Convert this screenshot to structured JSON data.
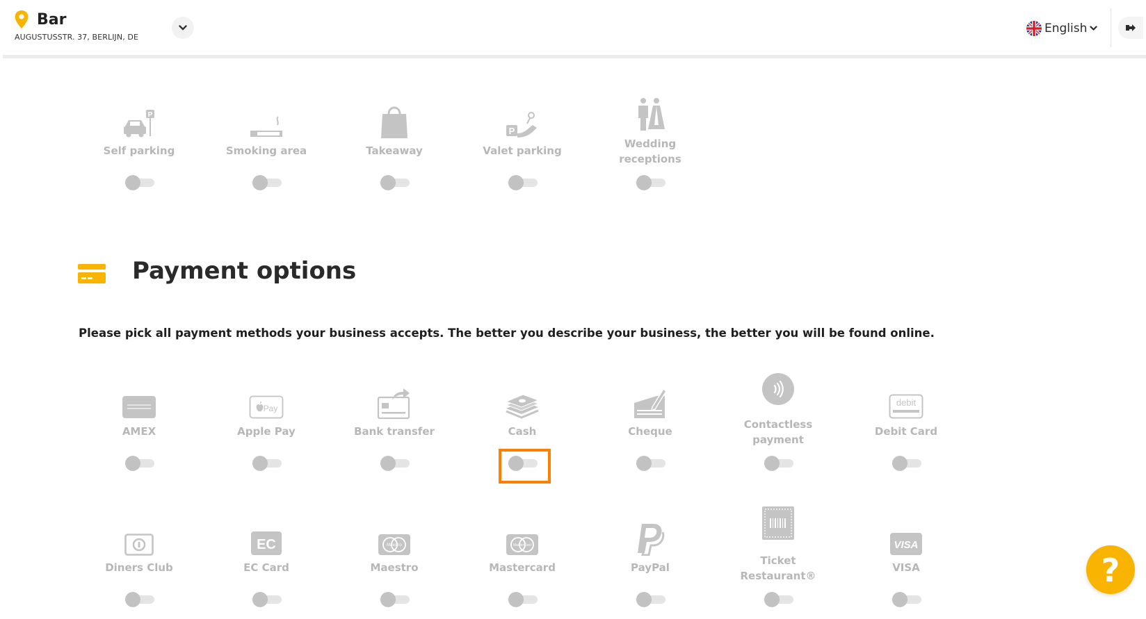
{
  "header": {
    "business_name": "Bar",
    "business_address": "AUGUSTUSSTR. 37, BERLIJN, DE",
    "language": "English"
  },
  "amenities": {
    "items": [
      {
        "label": "Self parking",
        "icon": "self-parking-icon",
        "enabled": false
      },
      {
        "label": "Smoking area",
        "icon": "cigarette-icon",
        "enabled": false
      },
      {
        "label": "Takeaway",
        "icon": "shopping-bag-icon",
        "enabled": false
      },
      {
        "label": "Valet parking",
        "icon": "valet-parking-icon",
        "enabled": false
      },
      {
        "label": "Wedding receptions",
        "icon": "wedding-couple-icon",
        "enabled": false
      }
    ]
  },
  "payment": {
    "title": "Payment options",
    "description": "Please pick all payment methods your business accepts. The better you describe your business, the better you will be found online.",
    "items": [
      {
        "label": "AMEX",
        "icon": "amex-icon",
        "enabled": false
      },
      {
        "label": "Apple Pay",
        "icon": "apple-pay-icon",
        "enabled": false
      },
      {
        "label": "Bank transfer",
        "icon": "bank-transfer-icon",
        "enabled": false
      },
      {
        "label": "Cash",
        "icon": "cash-icon",
        "enabled": false,
        "highlighted": true
      },
      {
        "label": "Cheque",
        "icon": "cheque-icon",
        "enabled": false
      },
      {
        "label": "Contactless payment",
        "icon": "contactless-icon",
        "enabled": false
      },
      {
        "label": "Debit Card",
        "icon": "debit-card-icon",
        "enabled": false
      },
      {
        "label": "Diners Club",
        "icon": "diners-club-icon",
        "enabled": false
      },
      {
        "label": "EC Card",
        "icon": "ec-card-icon",
        "enabled": false
      },
      {
        "label": "Maestro",
        "icon": "maestro-icon",
        "enabled": false
      },
      {
        "label": "Mastercard",
        "icon": "mastercard-icon",
        "enabled": false
      },
      {
        "label": "PayPal",
        "icon": "paypal-icon",
        "enabled": false
      },
      {
        "label": "Ticket Restaurant®",
        "icon": "ticket-restaurant-icon",
        "enabled": false
      },
      {
        "label": "VISA",
        "icon": "visa-icon",
        "enabled": false
      }
    ]
  },
  "icon_text": {
    "apple_pay": "Pay",
    "debit": "debit",
    "visa": "VISA",
    "ec": "EC",
    "maestro": "Maestro",
    "mastercard": "MasterCard",
    "parking_p": "P",
    "help": "?"
  },
  "colors": {
    "accent": "#f8b400",
    "highlight": "#ff7f00",
    "icon_gray": "#c4c4c4",
    "label_gray": "#b7b7b7"
  }
}
